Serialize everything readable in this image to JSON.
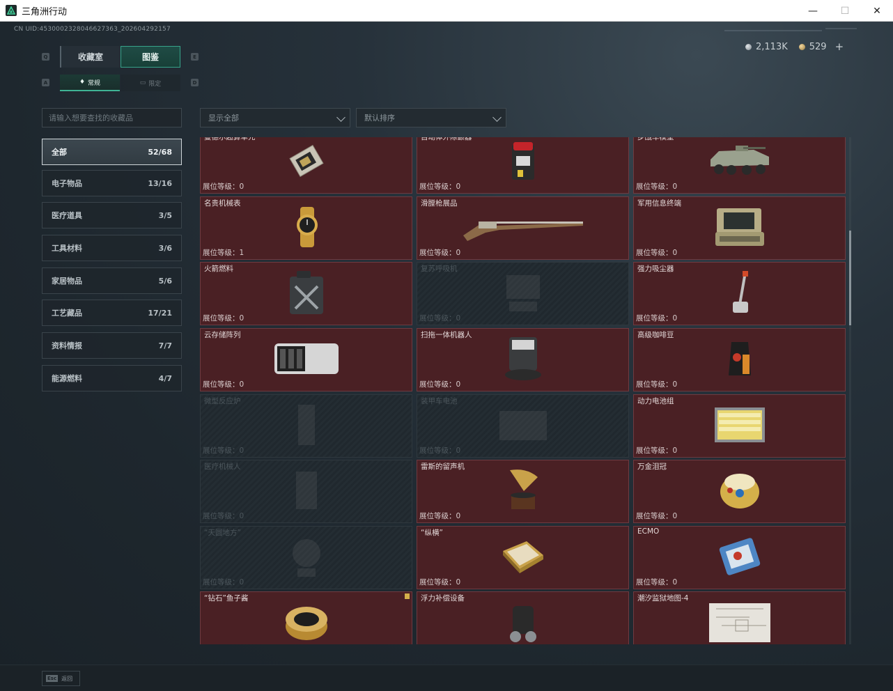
{
  "window": {
    "title": "三角洲行动",
    "minimize": "—",
    "maximize": "☐",
    "close": "✕"
  },
  "header": {
    "uid": "CN UID:4530002328046627363_202604292157",
    "currency_silver": "2,113K",
    "currency_gold": "529",
    "add": "+"
  },
  "tabs": {
    "key_left": "Q",
    "key_right": "E",
    "collection": "收藏室",
    "atlas": "图鉴",
    "subkey_left": "A",
    "subkey_right": "D",
    "normal": "常规",
    "limited": "限定"
  },
  "search": {
    "placeholder": "请输入想要查找的收藏品"
  },
  "filters": {
    "show": "显示全部",
    "sort": "默认排序"
  },
  "categories": [
    {
      "label": "全部",
      "count": "52/68"
    },
    {
      "label": "电子物品",
      "count": "13/16"
    },
    {
      "label": "医疗道具",
      "count": "3/5"
    },
    {
      "label": "工具材料",
      "count": "3/6"
    },
    {
      "label": "家居物品",
      "count": "5/6"
    },
    {
      "label": "工艺藏品",
      "count": "17/21"
    },
    {
      "label": "资料情报",
      "count": "7/7"
    },
    {
      "label": "能源燃料",
      "count": "4/7"
    }
  ],
  "items": [
    {
      "name": "曼德尔超算单元",
      "level": "展位等级：0",
      "icon": "gpu-icon",
      "locked": false
    },
    {
      "name": "自动体外除颤器",
      "level": "展位等级：0",
      "icon": "defibrillator-icon",
      "locked": false
    },
    {
      "name": "步战车模型",
      "level": "展位等级：0",
      "icon": "ifv-model-icon",
      "locked": false
    },
    {
      "name": "名贵机械表",
      "level": "展位等级：1",
      "icon": "watch-icon",
      "locked": false
    },
    {
      "name": "滑膛枪展品",
      "level": "展位等级：0",
      "icon": "musket-icon",
      "locked": false
    },
    {
      "name": "军用信息终端",
      "level": "展位等级：0",
      "icon": "terminal-icon",
      "locked": false
    },
    {
      "name": "火箭燃料",
      "level": "展位等级：0",
      "icon": "fuel-can-icon",
      "locked": false
    },
    {
      "name": "复苏呼吸机",
      "level": "展位等级：0",
      "icon": "ventilator-icon",
      "locked": true
    },
    {
      "name": "强力吸尘器",
      "level": "展位等级：0",
      "icon": "vacuum-icon",
      "locked": false
    },
    {
      "name": "云存储阵列",
      "level": "展位等级：0",
      "icon": "storage-array-icon",
      "locked": false
    },
    {
      "name": "扫拖一体机器人",
      "level": "展位等级：0",
      "icon": "robot-vacuum-icon",
      "locked": false
    },
    {
      "name": "高级咖啡豆",
      "level": "展位等级：0",
      "icon": "coffee-bag-icon",
      "locked": false
    },
    {
      "name": "微型反应炉",
      "level": "展位等级：0",
      "icon": "reactor-icon",
      "locked": true
    },
    {
      "name": "装甲车电池",
      "level": "展位等级：0",
      "icon": "battery-icon",
      "locked": true
    },
    {
      "name": "动力电池组",
      "level": "展位等级：0",
      "icon": "battery-pack-icon",
      "locked": false
    },
    {
      "name": "医疗机械人",
      "level": "展位等级：0",
      "icon": "medical-robot-icon",
      "locked": true
    },
    {
      "name": "雷斯的留声机",
      "level": "展位等级：0",
      "icon": "gramophone-icon",
      "locked": false
    },
    {
      "name": "万金泪冠",
      "level": "展位等级：0",
      "icon": "crown-icon",
      "locked": false
    },
    {
      "name": "“天圆地方”",
      "level": "展位等级：0",
      "icon": "globe-icon",
      "locked": true
    },
    {
      "name": "“纵横”",
      "level": "展位等级：0",
      "icon": "chessboard-icon",
      "locked": false
    },
    {
      "name": "ECMO",
      "level": "展位等级：0",
      "icon": "ecmo-icon",
      "locked": false
    },
    {
      "name": "“钻石”鱼子酱",
      "level": "",
      "icon": "caviar-icon",
      "locked": false,
      "new": true
    },
    {
      "name": "浮力补偿设备",
      "level": "",
      "icon": "bcd-icon",
      "locked": false
    },
    {
      "name": "潮汐监狱地图-4",
      "level": "",
      "icon": "map-icon",
      "locked": false
    }
  ],
  "footer": {
    "esc_key": "Esc",
    "esc_label": "返回"
  },
  "colors": {
    "accent": "#3fb495",
    "card_bg": "#4a2024",
    "locked_bg": "#242d33"
  }
}
